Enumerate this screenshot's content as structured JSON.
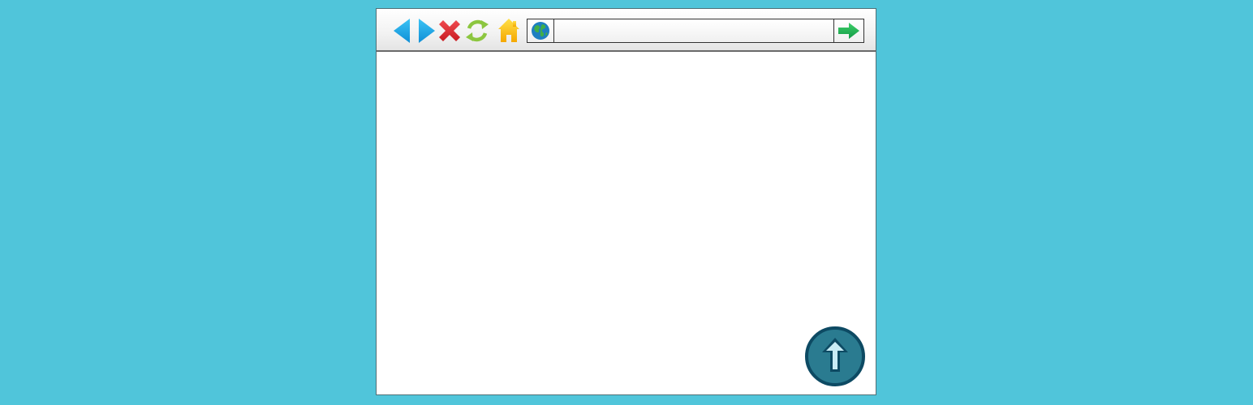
{
  "browser": {
    "toolbar": {
      "buttons": [
        {
          "icon": "back-arrow-icon",
          "color": "#1ba6e8"
        },
        {
          "icon": "forward-arrow-icon",
          "color": "#1ba6e8"
        },
        {
          "icon": "stop-x-icon",
          "color": "#e0262c"
        },
        {
          "icon": "refresh-icon",
          "color": "#8cc63f"
        },
        {
          "icon": "home-icon",
          "color": "#ffc20e"
        }
      ],
      "address_bar": {
        "url": "",
        "globe_icon": "globe-icon",
        "go_icon": "go-arrow-icon",
        "go_color": "#1fae4e"
      }
    },
    "content": {
      "scroll_to_top_icon": "arrow-up-icon",
      "scroll_to_top_color": "#2a7b90"
    }
  },
  "colors": {
    "background": "#50c5da",
    "window_border": "#4f6f76"
  }
}
